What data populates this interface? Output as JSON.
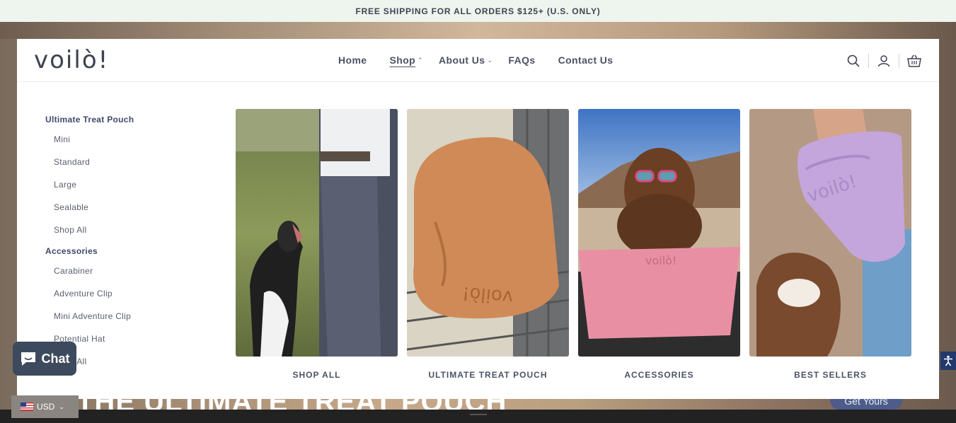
{
  "announcement": "FREE SHIPPING FOR ALL ORDERS $125+ (U.S. ONLY)",
  "logo": "voilò!",
  "nav": {
    "home": "Home",
    "shop": "Shop",
    "about": "About Us",
    "faqs": "FAQs",
    "contact": "Contact Us"
  },
  "menu": {
    "group1_title": "Ultimate Treat Pouch",
    "group1_items": [
      "Mini",
      "Standard",
      "Large",
      "Sealable",
      "Shop All"
    ],
    "group2_title": "Accessories",
    "group2_items": [
      "Carabiner",
      "Adventure Clip",
      "Mini Adventure Clip",
      "Potential Hat",
      "Shop All"
    ]
  },
  "cards": [
    {
      "label": "SHOP ALL"
    },
    {
      "label": "ULTIMATE TREAT POUCH"
    },
    {
      "label": "ACCESSORIES"
    },
    {
      "label": "BEST SELLERS"
    }
  ],
  "pouch_engraving": "voilò!",
  "hero_title": "THE ULTIMATE TREAT POUCH",
  "hero_button": "Get Yours",
  "chat_label": "Chat",
  "currency": "USD",
  "icons": [
    "search-icon",
    "account-icon",
    "cart-icon",
    "chat-icon",
    "accessibility-icon"
  ]
}
